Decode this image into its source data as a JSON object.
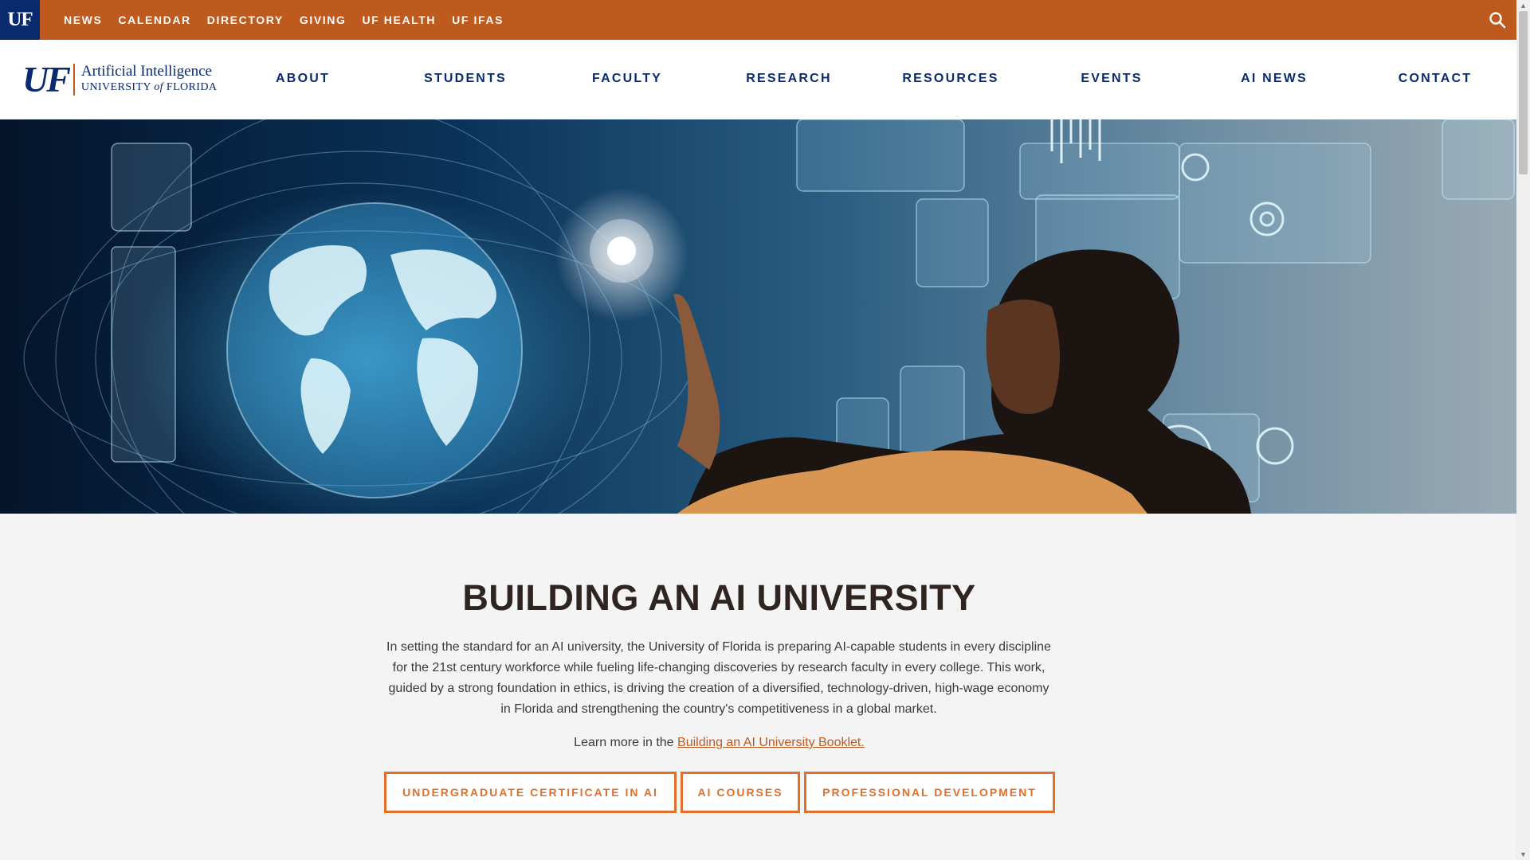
{
  "topbar": {
    "logo_label": "UF",
    "links": [
      "NEWS",
      "CALENDAR",
      "DIRECTORY",
      "GIVING",
      "UF HEALTH",
      "UF IFAS"
    ],
    "search_icon": "search-icon"
  },
  "site_logo": {
    "mark": "UF",
    "line1": "Artificial Intelligence",
    "line2_prefix": "UNIVERSITY ",
    "line2_of": "of",
    "line2_suffix": " FLORIDA"
  },
  "nav": {
    "items": [
      "ABOUT",
      "STUDENTS",
      "FACULTY",
      "RESEARCH",
      "RESOURCES",
      "EVENTS",
      "AI NEWS",
      "CONTACT"
    ]
  },
  "main": {
    "headline": "BUILDING AN AI UNIVERSITY",
    "intro": "In setting the standard for an AI university, the University of Florida is preparing AI-capable students in every discipline for the 21st century workforce while fueling life-changing discoveries by research faculty in every college. This work, guided by a strong foundation in ethics, is driving the creation of a diversified, technology-driven, high-wage economy in Florida and strengthening the country's competitiveness in a global market.",
    "learn_prefix": "Learn more in the ",
    "learn_link": "Building an AI University Booklet.",
    "buttons": [
      "UNDERGRADUATE CERTIFICATE IN AI",
      "AI COURSES",
      "PROFESSIONAL DEVELOPMENT"
    ]
  },
  "colors": {
    "brand_orange": "#bf5a1f",
    "brand_blue": "#0a2a70",
    "button_orange": "#e26f2b"
  }
}
